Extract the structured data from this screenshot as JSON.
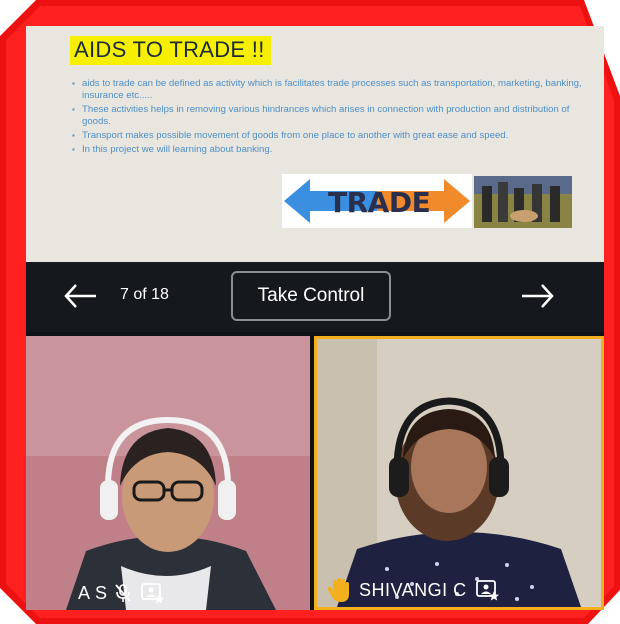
{
  "slide": {
    "title": "AIDS TO TRADE !!",
    "bullets": [
      "aids to trade can be defined as activity which is facilitates trade processes such as transportation, marketing, banking, insurance etc.....",
      "These activities helps in removing various hindrances which arises in connection with production and distribution of goods.",
      "Transport makes possible movement of goods from one place to another with great ease and speed.",
      "In this project we will learning about banking."
    ],
    "banner_text": "TRADE"
  },
  "presenter": {
    "page_count": "7 of 18",
    "take_control_label": "Take Control"
  },
  "participants": [
    {
      "name": "A S",
      "muted": true
    },
    {
      "name": "SHIVANGI C",
      "hand_raised": true
    }
  ],
  "colors": {
    "frame": "#ee1111",
    "slide_bg": "#e8e6de",
    "title_highlight": "#f6f000",
    "bullet_text": "#4f8fc8",
    "active_speaker_border": "#f2b01e",
    "control_bar": "#15181d"
  },
  "icons": [
    "arrow-left-icon",
    "arrow-right-icon",
    "mic-off-icon",
    "presenter-icon",
    "raised-hand-icon"
  ]
}
